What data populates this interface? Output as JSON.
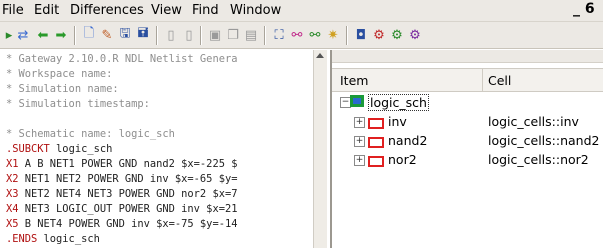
{
  "menu": {
    "items": [
      "File",
      "Edit",
      "Differences",
      "View",
      "Find",
      "Window"
    ],
    "window_control": "_ 6"
  },
  "toolbar": {
    "icons": [
      "sync-icon",
      "back-icon",
      "forward-icon",
      "new-icon",
      "config-icon",
      "save-icon",
      "save-all-icon",
      "page-icon",
      "page2-icon",
      "zoom-fit-icon",
      "copy-icon",
      "paste-icon",
      "binoculars-icon",
      "connect-icon",
      "connect2-icon",
      "highlight-icon",
      "chip-icon",
      "gear-icon",
      "gear2-icon",
      "settings-icon"
    ]
  },
  "editor": {
    "lines": [
      {
        "t": "* Gateway 2.10.0.R NDL Netlist Genera",
        "c": "cmt"
      },
      {
        "t": "* Workspace name:",
        "c": "cmt"
      },
      {
        "t": "* Simulation name:",
        "c": "cmt"
      },
      {
        "t": "* Simulation timestamp:",
        "c": "cmt"
      },
      {
        "t": "",
        "c": "cmt"
      },
      {
        "t": "* Schematic name: logic_sch",
        "c": "cmt"
      },
      {
        "k": ".SUBCKT",
        "t": " logic_sch"
      },
      {
        "k": "X1",
        "t": " A B NET1 POWER GND nand2 $x=-225 $"
      },
      {
        "k": "X2",
        "t": " NET1 NET2 POWER GND inv $x=-65 $y="
      },
      {
        "k": "X3",
        "t": " NET2 NET4 NET3 POWER GND nor2 $x=7"
      },
      {
        "k": "X4",
        "t": " NET3 LOGIC_OUT POWER GND inv $x=21"
      },
      {
        "k": "X5",
        "t": " B NET4 POWER GND inv $x=-75 $y=-14"
      },
      {
        "k": ".ENDS",
        "t": " logic_sch"
      }
    ]
  },
  "tree": {
    "columns": [
      "Item",
      "Cell"
    ],
    "root": {
      "label": "logic_sch"
    },
    "children": [
      {
        "label": "inv",
        "cell": "logic_cells::inv"
      },
      {
        "label": "nand2",
        "cell": "logic_cells::nand2"
      },
      {
        "label": "nor2",
        "cell": "logic_cells::nor2"
      }
    ]
  },
  "colors": {
    "keyword": "#b01010",
    "comment": "#8e8e8e",
    "instance_icon": "#e02020"
  }
}
